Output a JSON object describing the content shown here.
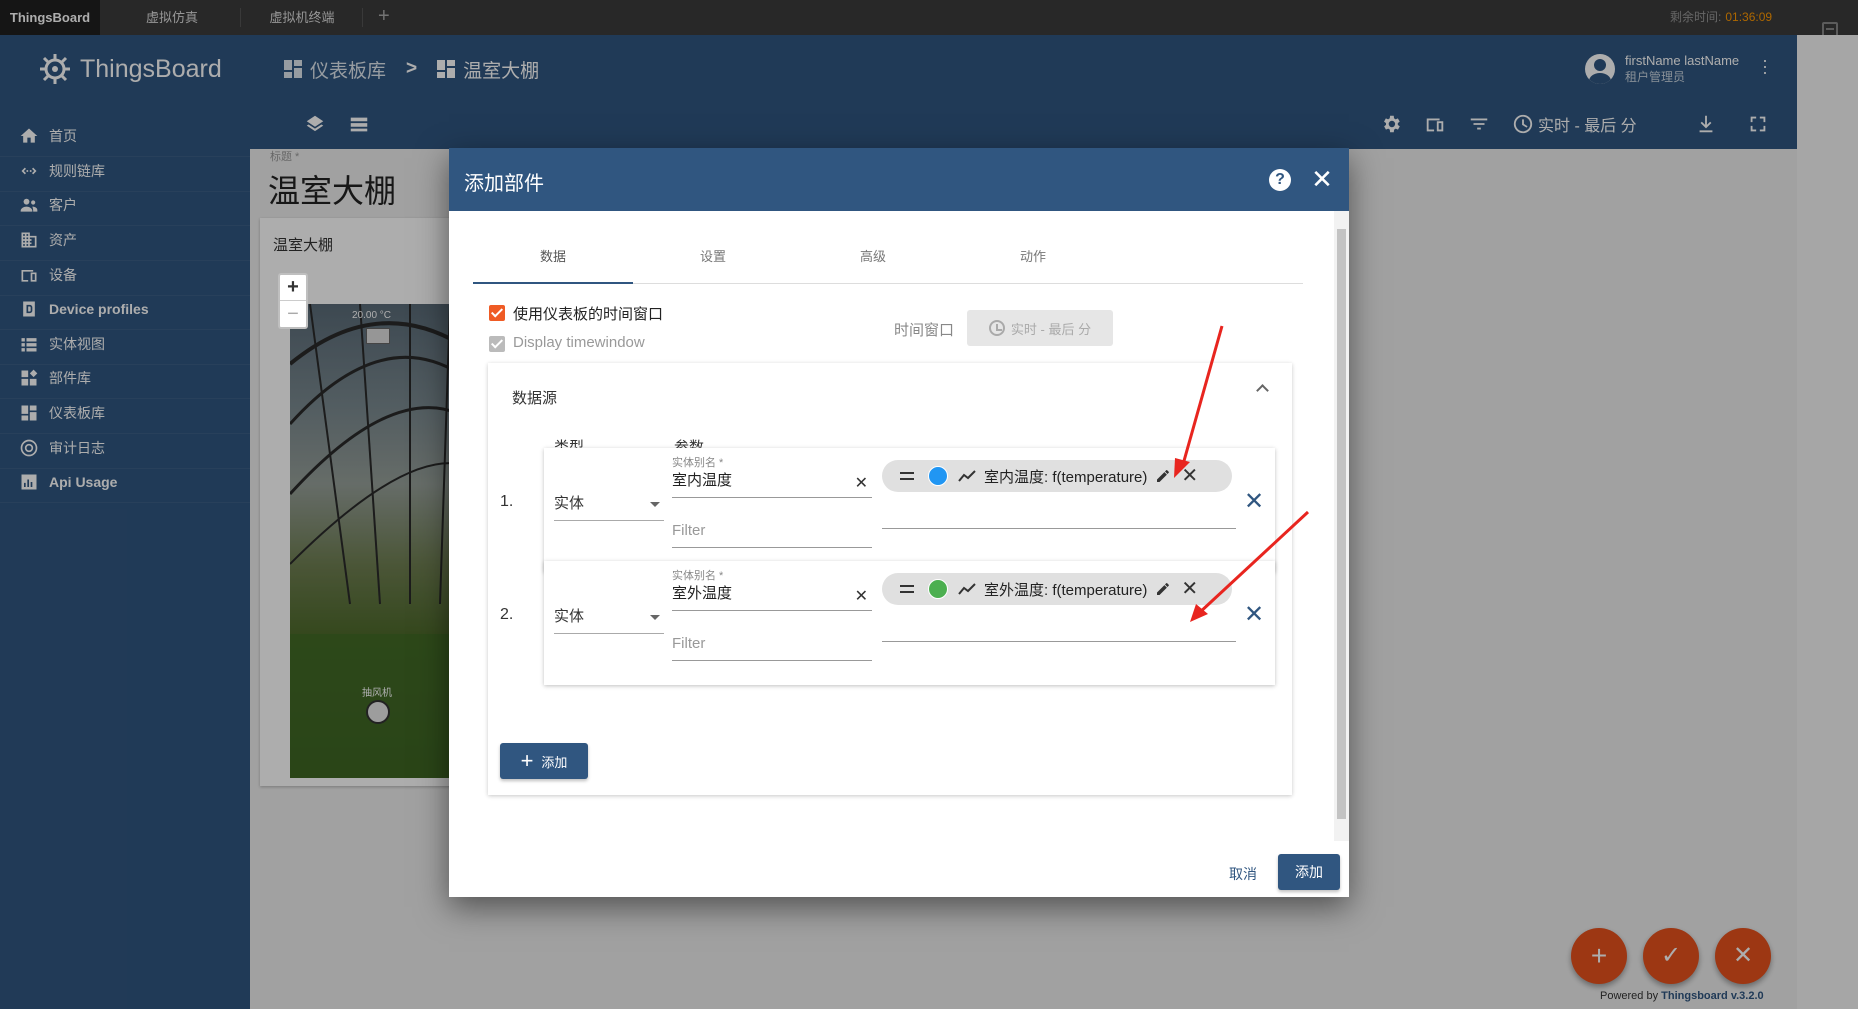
{
  "browser_tabs": [
    {
      "label": "ThingsBoard",
      "active": true
    },
    {
      "label": "虚拟仿真",
      "active": false
    },
    {
      "label": "虚拟机终端",
      "active": false
    }
  ],
  "timer": {
    "label": "剩余时间:",
    "value": "01:36:09"
  },
  "sidebar": {
    "logo_text": "ThingsBoard",
    "items": [
      {
        "label": "首页",
        "icon": "home-icon"
      },
      {
        "label": "规则链库",
        "icon": "rule-chain-icon"
      },
      {
        "label": "客户",
        "icon": "customers-icon"
      },
      {
        "label": "资产",
        "icon": "assets-icon"
      },
      {
        "label": "设备",
        "icon": "devices-icon"
      },
      {
        "label": "Device profiles",
        "icon": "device-profiles-icon"
      },
      {
        "label": "实体视图",
        "icon": "entity-views-icon"
      },
      {
        "label": "部件库",
        "icon": "widgets-library-icon"
      },
      {
        "label": "仪表板库",
        "icon": "dashboards-icon"
      },
      {
        "label": "审计日志",
        "icon": "audit-log-icon"
      },
      {
        "label": "Api Usage",
        "icon": "api-usage-icon"
      }
    ]
  },
  "header": {
    "breadcrumb": {
      "parent": "仪表板库",
      "separator": ">",
      "current": "温室大棚"
    },
    "user": {
      "name": "firstName lastName",
      "role": "租户管理员"
    },
    "timewindow_label": "实时 - 最后 分"
  },
  "dashboard": {
    "title_label": "标题 *",
    "title": "温室大棚",
    "widget_title": "温室大棚",
    "image_temp": "20.00 °C",
    "image_fan_label": "抽风机"
  },
  "modal": {
    "title": "添加部件",
    "tabs": [
      "数据",
      "设置",
      "高级",
      "动作"
    ],
    "use_dashboard_timewindow": "使用仪表板的时间窗口",
    "display_timewindow": "Display timewindow",
    "timewindow_label": "时间窗口",
    "timewindow_value": "实时 - 最后 分",
    "datasources_title": "数据源",
    "col_type": "类型",
    "col_params": "参数",
    "datasources": [
      {
        "index": "1.",
        "type": "实体",
        "alias_label": "实体别名 *",
        "alias": "室内温度",
        "filter_placeholder": "Filter",
        "key_label": "室内温度: f(temperature)",
        "key_color": "#2196f3"
      },
      {
        "index": "2.",
        "type": "实体",
        "alias_label": "实体别名 *",
        "alias": "室外温度",
        "filter_placeholder": "Filter",
        "key_label": "室外温度: f(temperature)",
        "key_color": "#4caf50"
      }
    ],
    "add_datasource_label": "添加",
    "cancel_label": "取消",
    "confirm_label": "添加"
  },
  "footer": {
    "powered_prefix": "Powered by",
    "powered_link": "Thingsboard v.3.2.0"
  },
  "colors": {
    "primary": "#305680",
    "accent": "#e8511d",
    "checkbox": "#ef5b25"
  }
}
